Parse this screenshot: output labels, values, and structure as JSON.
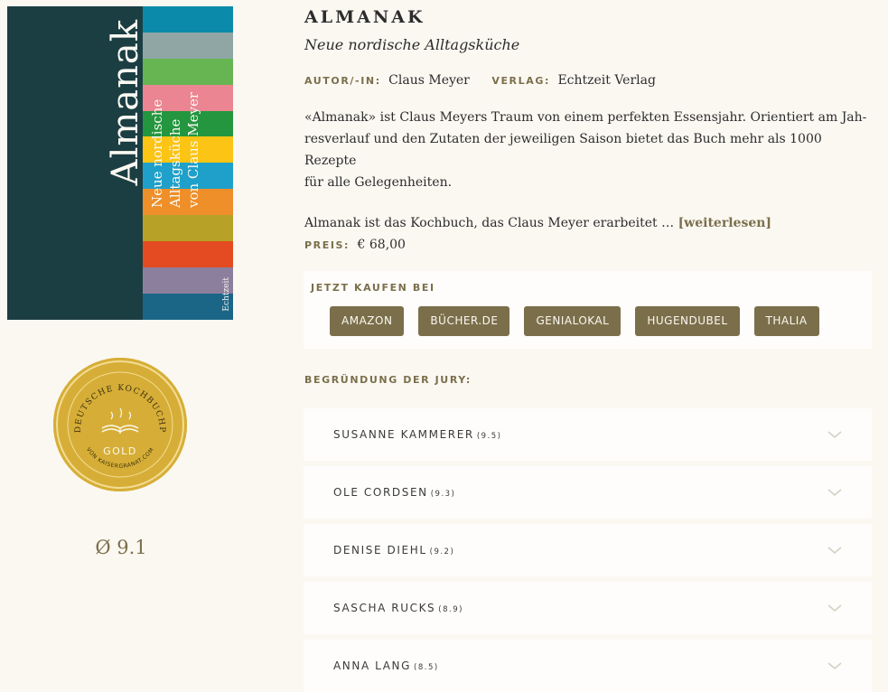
{
  "cover": {
    "title": "Almanak",
    "subtitle_line1": "Neue nordische Alltagsküche",
    "subtitle_line2": "von Claus Meyer",
    "publisher_mark": "Echtzeit",
    "stripe_colors": [
      "#0b8ba9",
      "#8fa6a5",
      "#66b552",
      "#ea8591",
      "#23963f",
      "#fcc414",
      "#1fa0ca",
      "#ee8f2a",
      "#b7a126",
      "#e54b22",
      "#8c7f9e",
      "#1b6687"
    ]
  },
  "medal": {
    "top_text": "DER DEUTSCHE KOCHBUCHPREIS",
    "level": "GOLD",
    "bottom_text": "VON KAISERGRANAT.COM"
  },
  "average": "Ø 9.1",
  "book": {
    "title": "ALMANAK",
    "subtitle": "Neue nordische Alltagsküche",
    "author_label": "AUTOR/-IN:",
    "author": "Claus Meyer",
    "publisher_label": "VERLAG:",
    "publisher": "Echtzeit Verlag",
    "desc_p1_l1": "«Almanak» ist Claus Meyers Traum von einem perfekten Essensjahr. Orientiert am Jah-",
    "desc_p1_l2": "resverlauf und den Zutaten der jeweiligen Saison bietet das Buch mehr als 1000 Rezepte",
    "desc_p1_l3": "für alle Gelegenheiten.",
    "desc_p2": "Almanak ist das Kochbuch, das Claus Meyer erarbeitet … ",
    "read_more": "[weiterlesen]",
    "price_label": "PREIS:",
    "price": "€ 68,00"
  },
  "buy": {
    "label": "JETZT KAUFEN BEI",
    "shops": [
      "AMAZON",
      "BÜCHER.DE",
      "GENIALOKAL",
      "HUGENDUBEL",
      "THALIA"
    ]
  },
  "jury": {
    "label": "BEGRÜNDUNG DER JURY:",
    "members": [
      {
        "name": "SUSANNE KAMMERER",
        "score": "(9.5)"
      },
      {
        "name": "OLE CORDSEN",
        "score": "(9.3)"
      },
      {
        "name": "DENISE DIEHL",
        "score": "(9.2)"
      },
      {
        "name": "SASCHA RUCKS",
        "score": "(8.9)"
      },
      {
        "name": "ANNA LANG",
        "score": "(8.5)"
      }
    ]
  },
  "colors": {
    "accent": "#7b6f4b",
    "gold": "#d6ae37",
    "background": "#fbf8f2",
    "cover": "#1b3e43"
  }
}
